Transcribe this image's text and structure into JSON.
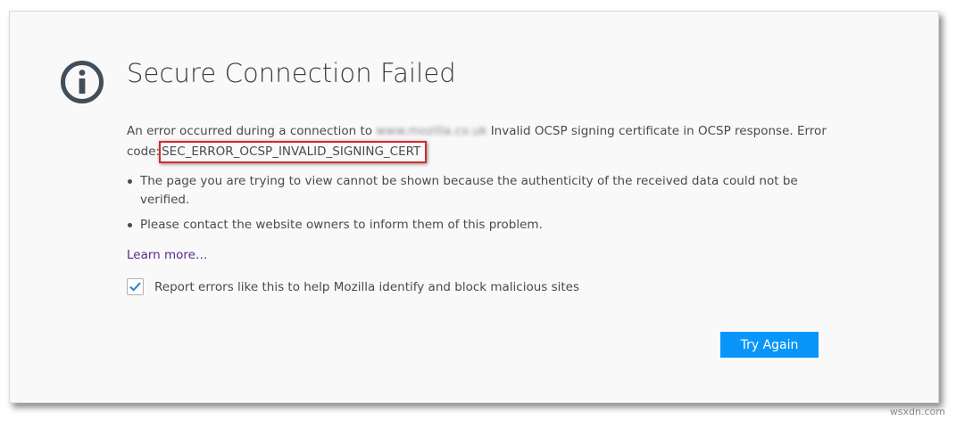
{
  "page": {
    "title": "Secure Connection Failed",
    "description": {
      "prefix": "An error occurred during a connection to",
      "hostname_obscured": "www.mozilla.co.uk",
      "message": "Invalid OCSP signing certificate in OCSP response. Error code:",
      "error_code": "SEC_ERROR_OCSP_INVALID_SIGNING_CERT"
    },
    "bullets": [
      "The page you are trying to view cannot be shown because the authenticity of the received data could not be verified.",
      "Please contact the website owners to inform them of this problem."
    ],
    "learn_more": "Learn more…",
    "report": {
      "label": "Report errors like this to help Mozilla identify and block malicious sites",
      "checked": true
    },
    "try_again": "Try Again"
  },
  "watermark": "wsxdn.com",
  "colors": {
    "background": "#f9f9fa",
    "primary_button": "#0996f8",
    "link": "#5b2a8a",
    "highlight_box": "#d42a2a",
    "icon": "#424e5a"
  },
  "icons": {
    "info": "info-circle-icon",
    "check": "checkmark-icon"
  }
}
